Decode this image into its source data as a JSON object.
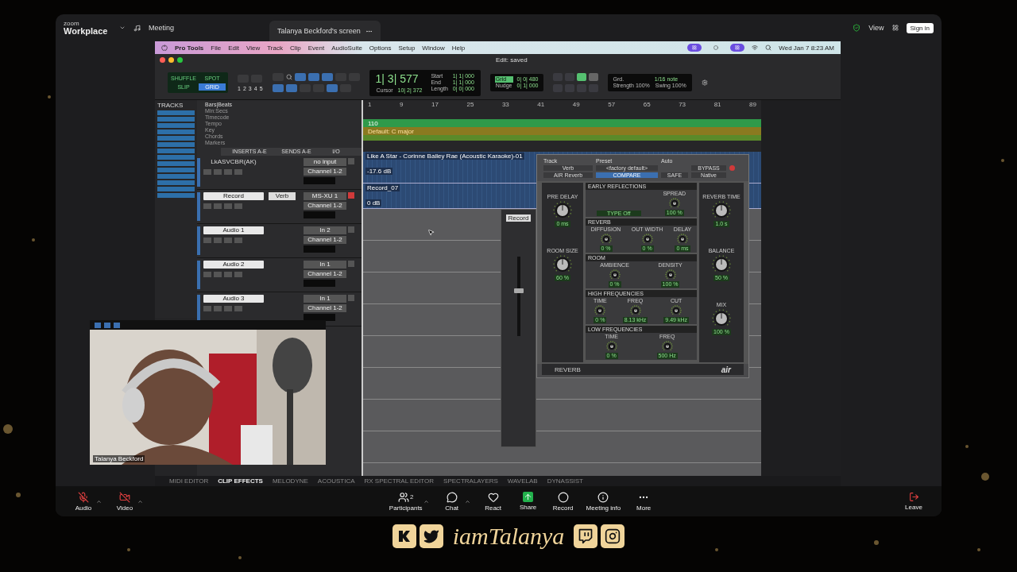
{
  "zoom": {
    "brand_small": "zoom",
    "brand": "Workplace",
    "meeting": "Meeting",
    "share_label": "Talanya Beckford's screen",
    "view": "View",
    "sign_in": "Sign in"
  },
  "menu_bar": {
    "items": [
      "Pro Tools",
      "File",
      "Edit",
      "View",
      "Track",
      "Clip",
      "Event",
      "AudioSuite",
      "Options",
      "Setup",
      "Window",
      "Help"
    ],
    "clock": "Wed Jan 7  8:23 AM"
  },
  "edit_window": {
    "title": "Edit: saved",
    "edit_modes": [
      {
        "label": "SHUFFLE",
        "selected": false
      },
      {
        "label": "SPOT",
        "selected": false
      },
      {
        "label": "SLIP",
        "selected": false
      },
      {
        "label": "GRID",
        "selected": true
      }
    ],
    "zoom_presets": [
      "1",
      "2",
      "3",
      "4",
      "5"
    ],
    "counter": "1| 3| 577",
    "range": [
      {
        "label": "Start",
        "value": "1| 1| 000"
      },
      {
        "label": "End",
        "value": "1| 1| 000"
      },
      {
        "label": "Length",
        "value": "0| 0| 000"
      }
    ],
    "cursor_label": "Cursor",
    "cursor_value": "10| 2| 372",
    "grid": [
      {
        "label": "Grid",
        "value": "0| 0| 480"
      },
      {
        "label": "Nudge",
        "value": "0| 1| 000"
      }
    ],
    "quantize": {
      "label": "Grd.",
      "value": "1/16 note",
      "strength_label": "Strength",
      "strength": "100%",
      "swing_label": "Swing",
      "swing": "100%"
    },
    "tracks_list": {
      "title": "TRACKS"
    },
    "rulers": [
      "Bars|Beats",
      "Min:Secs",
      "Timecode",
      "Tempo",
      "Key",
      "Chords",
      "Markers"
    ],
    "columns": [
      "INSERTS A-E",
      "SENDS A-E",
      "I/O"
    ],
    "tracks": [
      {
        "name": "LkASVCBR(AK)",
        "input": "no input",
        "output": "Channel 1-2",
        "record_enabled": false
      },
      {
        "name": "Record",
        "send": "Verb",
        "input": "MS-XU 1",
        "output": "Channel 1-2",
        "record_enabled": true
      },
      {
        "name": "Audio 1",
        "input": "In 2",
        "output": "Channel 1-2",
        "record_enabled": false
      },
      {
        "name": "Audio 2",
        "input": "In 1",
        "output": "Channel 1-2",
        "record_enabled": false
      },
      {
        "name": "Audio 3",
        "input": "In 1",
        "output": "Channel 1-2",
        "record_enabled": false
      }
    ],
    "bars": [
      "1",
      "9",
      "17",
      "25",
      "33",
      "41",
      "49",
      "57",
      "65",
      "73",
      "81",
      "89"
    ],
    "tempo": "110",
    "key": "Default: C major",
    "clips": [
      {
        "name": "Like A Star - Corinne Bailey Rae (Acoustic Karaoke)-01",
        "gain": "-17.6 dB"
      },
      {
        "name": "Record_07",
        "gain": "0 dB"
      }
    ],
    "bottom_tabs": [
      {
        "label": "MIDI EDITOR",
        "selected": false
      },
      {
        "label": "CLIP EFFECTS",
        "selected": true
      },
      {
        "label": "MELODYNE",
        "selected": false
      },
      {
        "label": "ACOUSTICA",
        "selected": false
      },
      {
        "label": "RX SPECTRAL EDITOR",
        "selected": false
      },
      {
        "label": "SPECTRALAYERS",
        "selected": false
      },
      {
        "label": "WAVELAB",
        "selected": false
      },
      {
        "label": "DYNASSIST",
        "selected": false
      }
    ]
  },
  "output_window": {
    "name": "Record"
  },
  "plugin": {
    "track_label": "Track",
    "preset_label": "Preset",
    "auto_label": "Auto",
    "track": "Verb",
    "preset": "<factory default>",
    "plugin_name": "AIR Reverb",
    "compare": "COMPARE",
    "bypass": "BYPASS",
    "safe": "SAFE",
    "native": "Native",
    "left": [
      {
        "label": "PRE DELAY",
        "value": "0 ms"
      },
      {
        "label": "ROOM SIZE",
        "value": "60 %"
      }
    ],
    "sections": [
      {
        "title": "EARLY REFLECTIONS",
        "knobs": [
          {
            "label": "TYPE",
            "value": "Off",
            "kind": "menu"
          },
          {
            "label": "SPREAD",
            "value": "100 %",
            "kind": "knob"
          }
        ]
      },
      {
        "title": "REVERB",
        "knobs": [
          {
            "label": "DIFFUSION",
            "value": "0 %",
            "kind": "knob"
          },
          {
            "label": "OUT WIDTH",
            "value": "0 %",
            "kind": "knob"
          },
          {
            "label": "DELAY",
            "value": "0 ms",
            "kind": "knob"
          }
        ]
      },
      {
        "title": "ROOM",
        "knobs": [
          {
            "label": "AMBIENCE",
            "value": "0 %",
            "kind": "knob"
          },
          {
            "label": "DENSITY",
            "value": "100 %",
            "kind": "knob"
          }
        ]
      },
      {
        "title": "HIGH FREQUENCIES",
        "knobs": [
          {
            "label": "TIME",
            "value": "0 %",
            "kind": "knob"
          },
          {
            "label": "FREQ",
            "value": "8.13 kHz",
            "kind": "knob"
          },
          {
            "label": "CUT",
            "value": "9.49 kHz",
            "kind": "knob"
          }
        ]
      },
      {
        "title": "LOW FREQUENCIES",
        "knobs": [
          {
            "label": "TIME",
            "value": "0 %",
            "kind": "knob"
          },
          {
            "label": "FREQ",
            "value": "500 Hz",
            "kind": "knob"
          }
        ]
      }
    ],
    "right": [
      {
        "label": "REVERB TIME",
        "value": "1.0 s"
      },
      {
        "label": "BALANCE",
        "value": "50 %"
      },
      {
        "label": "MIX",
        "value": "100 %"
      }
    ],
    "footer": "REVERB",
    "logo": "air"
  },
  "video": {
    "name": "Talanya Beckford",
    "kind": "picture"
  },
  "toolbar": [
    {
      "label": "Audio",
      "kind": "audio",
      "off": true
    },
    {
      "label": "Video",
      "kind": "video",
      "off": true
    },
    {
      "label": "Participants",
      "kind": "participants",
      "count": "2"
    },
    {
      "label": "Chat",
      "kind": "chat"
    },
    {
      "label": "React",
      "kind": "react"
    },
    {
      "label": "Share",
      "kind": "share"
    },
    {
      "label": "Record",
      "kind": "record"
    },
    {
      "label": "Meeting info",
      "kind": "info"
    },
    {
      "label": "More",
      "kind": "more"
    }
  ],
  "leave": "Leave",
  "banner": {
    "handle": "iamTalanya"
  }
}
